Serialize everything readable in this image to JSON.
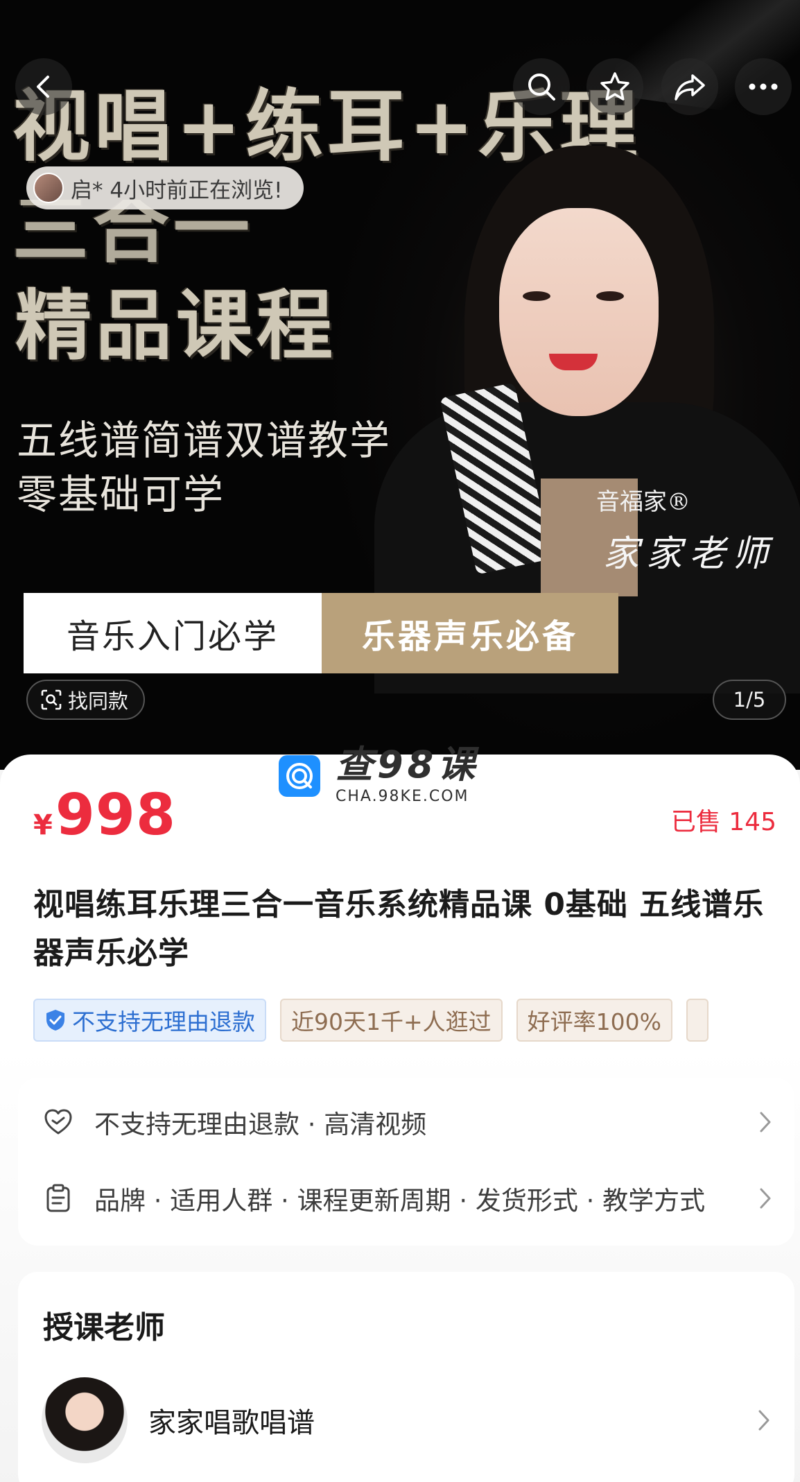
{
  "hero": {
    "brush_line_1": "视唱+练耳+乐理",
    "brush_line_2": "三合一",
    "brush_line_3": "精品课程",
    "subtitle_1": "五线谱简谱双谱教学",
    "subtitle_2": "零基础可学",
    "brand": "音福家®",
    "teacher_sign": "家家老师",
    "tag_left": "音乐入门必学",
    "tag_right": "乐器声乐必备",
    "browse_notice": "启* 4小时前正在浏览!",
    "find_same": "找同款",
    "pager": "1/5"
  },
  "watermark": {
    "main": "查98课",
    "sub": "CHA.98KE.COM"
  },
  "product": {
    "currency": "¥",
    "price": "998",
    "sold": "已售 145",
    "title": "视唱练耳乐理三合一音乐系统精品课 0基础 五线谱乐器声乐必学",
    "chips": [
      {
        "label": "不支持无理由退款",
        "style": "blue",
        "icon": "shield-check-icon"
      },
      {
        "label": "近90天1千+人逛过",
        "style": "tan"
      },
      {
        "label": "好评率100%",
        "style": "tan"
      }
    ]
  },
  "info": {
    "row1": "不支持无理由退款 · 高清视频",
    "row2": "品牌 · 适用人群 · 课程更新周期 · 发货形式 · 教学方式"
  },
  "teacher": {
    "section_title": "授课老师",
    "name": "家家唱歌唱谱"
  },
  "colors": {
    "price_red": "#ec2c3e",
    "gold_tag": "#b9a17b",
    "blue_chip": "#2d6fd1"
  }
}
